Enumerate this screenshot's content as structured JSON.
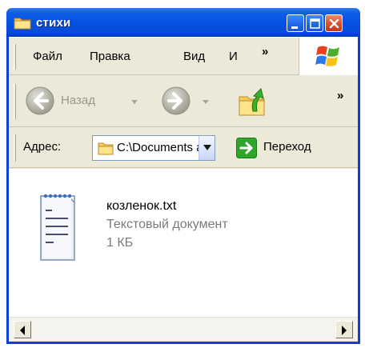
{
  "window": {
    "title": "стихи",
    "accent": "#0a4ad8",
    "icons": {
      "folder": "folder-icon",
      "minimize": "minimize-icon",
      "maximize": "maximize-icon",
      "close": "close-icon"
    }
  },
  "menubar": {
    "items": [
      "Файл",
      "Правка",
      "Вид",
      "И"
    ],
    "overflow": "»",
    "logo_icon": "windows-logo-icon"
  },
  "toolbar": {
    "back_label": "Назад",
    "overflow": "»",
    "icons": {
      "back": "back-arrow-icon",
      "forward": "forward-arrow-icon",
      "up": "up-folder-icon"
    }
  },
  "addressbar": {
    "label": "Адрес:",
    "value": "C:\\Documents and Settings",
    "go_label": "Переход",
    "icons": {
      "folder": "folder-icon",
      "go": "go-arrow-icon"
    }
  },
  "files": [
    {
      "name": "козленок.txt",
      "type": "Текстовый документ",
      "size": "1 КБ",
      "icon": "notepad-document-icon"
    }
  ]
}
